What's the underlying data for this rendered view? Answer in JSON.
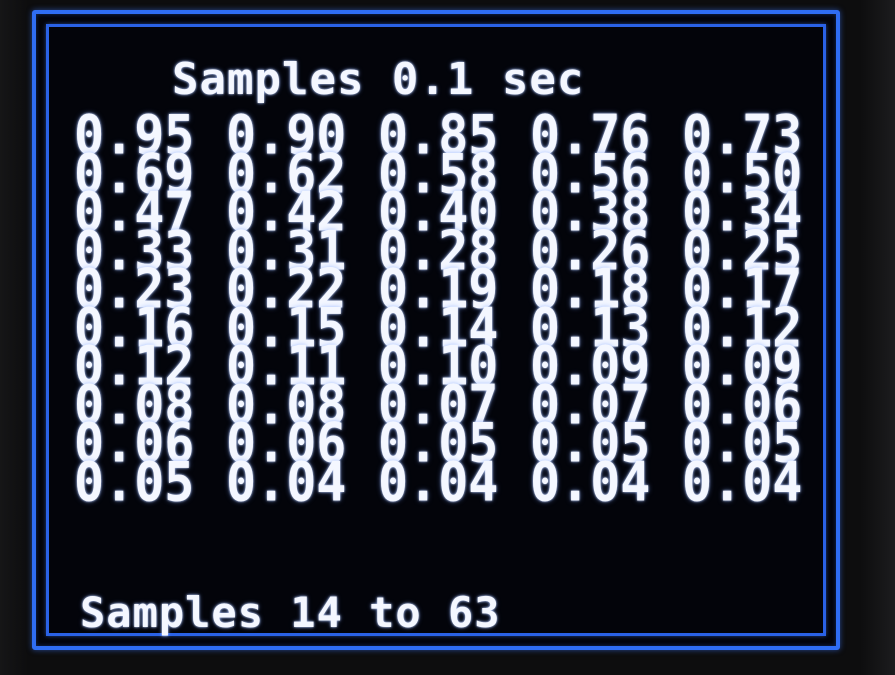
{
  "display": {
    "title": "Samples 0.1 sec",
    "footer": "Samples 14 to 63",
    "colors": {
      "border": "#2f6df2",
      "text": "#f4f7ff",
      "background": "#03040a"
    }
  },
  "samples": [
    [
      "0.95",
      "0.90",
      "0.85",
      "0.76",
      "0.73"
    ],
    [
      "0.69",
      "0.62",
      "0.58",
      "0.56",
      "0.50"
    ],
    [
      "0.47",
      "0.42",
      "0.40",
      "0.38",
      "0.34"
    ],
    [
      "0.33",
      "0.31",
      "0.28",
      "0.26",
      "0.25"
    ],
    [
      "0.23",
      "0.22",
      "0.19",
      "0.18",
      "0.17"
    ],
    [
      "0.16",
      "0.15",
      "0.14",
      "0.13",
      "0.12"
    ],
    [
      "0.12",
      "0.11",
      "0.10",
      "0.09",
      "0.09"
    ],
    [
      "0.08",
      "0.08",
      "0.07",
      "0.07",
      "0.06"
    ],
    [
      "0.06",
      "0.06",
      "0.05",
      "0.05",
      "0.05"
    ],
    [
      "0.05",
      "0.04",
      "0.04",
      "0.04",
      "0.04"
    ]
  ]
}
